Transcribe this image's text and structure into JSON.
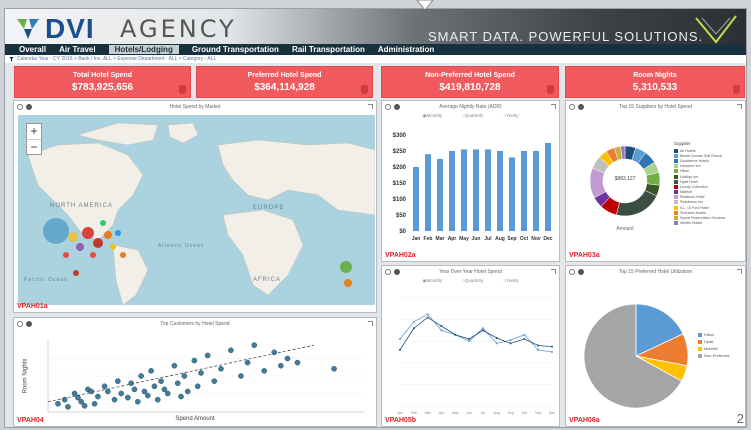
{
  "header": {
    "logo": "DVI",
    "agency": "AGENCY",
    "tagline": "SMART DATA. POWERFUL SOLUTIONS."
  },
  "nav": [
    "Overall",
    "Air Travel",
    "Hotels/Lodging",
    "Ground Transportation",
    "Rail Transportation",
    "Administration"
  ],
  "nav_active": 2,
  "filters": "Calendar Year - CY 2016 > Bank / Inc. ALL > Expense Department - ALL > Category - ALL",
  "kpis": [
    {
      "label": "Total Hotel Spend",
      "value": "$783,925,656"
    },
    {
      "label": "Preferred Hotel Spend",
      "value": "$364,114,928"
    },
    {
      "label": "Non-Preferred Hotel Spend",
      "value": "$419,810,728"
    },
    {
      "label": "Room Nights",
      "value": "5,310,533"
    }
  ],
  "panels": {
    "map": {
      "title": "Hotel Spend by Market",
      "code": "VPAH01a",
      "zoom_in": "+",
      "zoom_out": "−",
      "labels": [
        "NORTH AMERICA",
        "EUROPE",
        "AFRICA",
        "Atlantic Ocean",
        "Pacific Ocean"
      ]
    },
    "adr": {
      "title": "Average Nightly Rate (ADR)",
      "code": "VPAH02a",
      "options": [
        "Monthly",
        "Quarterly",
        "Yearly"
      ]
    },
    "suppliers": {
      "title": "Top 15 Suppliers by Hotel Spend",
      "code": "VPAH03a",
      "center_value": "$883,127",
      "inner_label": "Amount",
      "legend_title": "Supplier"
    },
    "yoy": {
      "title": "Year Over Year Hotel Spend",
      "code": "VPAH05b",
      "options": [
        "Monthly",
        "Quarterly",
        "Yearly"
      ]
    },
    "customers": {
      "title": "Top Customers by Hotel Spend",
      "code": "VPAH04",
      "xlabel": "Spend Amount",
      "ylabel": "Room Nights"
    },
    "preferred": {
      "title": "Top 15 Preferred Hotel Utilization",
      "code": "VPAH06a"
    }
  },
  "page_number": "2",
  "colors": {
    "kpi": "#f05a5f",
    "bar": "#5b9bd5",
    "nav": "#17313f",
    "code": "#e3232b"
  },
  "chart_data": [
    {
      "type": "bar",
      "title": "Average Nightly Rate (ADR)",
      "categories": [
        "Jan",
        "Feb",
        "Mar",
        "Apr",
        "May",
        "Jun",
        "Jul",
        "Aug",
        "Sep",
        "Oct",
        "Nov",
        "Dec"
      ],
      "values": [
        200,
        240,
        225,
        250,
        255,
        255,
        255,
        250,
        230,
        250,
        250,
        275
      ],
      "yticks": [
        "$300",
        "$250",
        "$200",
        "$150",
        "$100",
        "$50",
        "$0"
      ],
      "ylim": [
        0,
        300
      ]
    },
    {
      "type": "pie",
      "title": "Top 15 Suppliers by Hotel Spend",
      "donut": true,
      "series": [
        {
          "name": "Air Hotels",
          "value": 5,
          "color": "#1f4e79"
        },
        {
          "name": "Baxter Dumas Golf Resort",
          "value": 5,
          "color": "#5b9bd5"
        },
        {
          "name": "Doubletree Hotels",
          "value": 6,
          "color": "#2e75b6"
        },
        {
          "name": "Hampton Inn",
          "value": 5,
          "color": "#a9d18e"
        },
        {
          "name": "Hilton",
          "value": 6,
          "color": "#70ad47"
        },
        {
          "name": "Holiday Inn",
          "value": 5,
          "color": "#385723"
        },
        {
          "name": "Hyatt Hotel",
          "value": 22,
          "color": "#3a4e42"
        },
        {
          "name": "Luxury Collection",
          "value": 8,
          "color": "#c00000"
        },
        {
          "name": "Marriott",
          "value": 5,
          "color": "#7030a0"
        },
        {
          "name": "Radisson Hotel",
          "value": 14,
          "color": "#c39bd3"
        },
        {
          "name": "Residence Inn",
          "value": 6,
          "color": "#bfbfbf"
        },
        {
          "name": "S.L. Gl Ford Hotel",
          "value": 4,
          "color": "#ffc000"
        },
        {
          "name": "Sheraton Hotels",
          "value": 4,
          "color": "#ed7d31"
        },
        {
          "name": "Synrel Reservation Services",
          "value": 3,
          "color": "#c9b03c"
        },
        {
          "name": "Westin Hotels",
          "value": 2,
          "color": "#8e7cc3"
        }
      ]
    },
    {
      "type": "line",
      "title": "Year Over Year Hotel Spend",
      "x": [
        "Jan",
        "Feb",
        "Mar",
        "Apr",
        "May",
        "Jun",
        "Jul",
        "Aug",
        "Sep",
        "Oct",
        "Nov",
        "Dec"
      ],
      "series": [
        {
          "values": [
            62,
            78,
            85,
            70,
            66,
            60,
            72,
            58,
            61,
            66,
            52,
            50
          ]
        },
        {
          "values": [
            52,
            72,
            82,
            74,
            66,
            62,
            70,
            63,
            58,
            62,
            56,
            55
          ]
        }
      ]
    },
    {
      "type": "scatter",
      "title": "Top Customers by Hotel Spend",
      "xlabel": "Spend Amount",
      "ylabel": "Room Nights",
      "points": [
        [
          5,
          12
        ],
        [
          8,
          18
        ],
        [
          10,
          10
        ],
        [
          12,
          22
        ],
        [
          14,
          8
        ],
        [
          15,
          15
        ],
        [
          17,
          25
        ],
        [
          18,
          20
        ],
        [
          20,
          12
        ],
        [
          21,
          30
        ],
        [
          22,
          18
        ],
        [
          24,
          14
        ],
        [
          25,
          28
        ],
        [
          26,
          22
        ],
        [
          27,
          10
        ],
        [
          28,
          35
        ],
        [
          29,
          20
        ],
        [
          30,
          16
        ],
        [
          31,
          40
        ],
        [
          32,
          25
        ],
        [
          33,
          12
        ],
        [
          34,
          30
        ],
        [
          35,
          22
        ],
        [
          36,
          18
        ],
        [
          38,
          45
        ],
        [
          39,
          28
        ],
        [
          40,
          15
        ],
        [
          41,
          35
        ],
        [
          42,
          20
        ],
        [
          44,
          50
        ],
        [
          45,
          25
        ],
        [
          46,
          38
        ],
        [
          48,
          55
        ],
        [
          50,
          30
        ],
        [
          52,
          42
        ],
        [
          55,
          60
        ],
        [
          58,
          35
        ],
        [
          60,
          48
        ],
        [
          62,
          65
        ],
        [
          65,
          40
        ],
        [
          68,
          58
        ],
        [
          70,
          45
        ],
        [
          72,
          52
        ],
        [
          75,
          48
        ],
        [
          86,
          42
        ],
        [
          3,
          8
        ],
        [
          6,
          5
        ],
        [
          9,
          14
        ],
        [
          11,
          6
        ],
        [
          13,
          20
        ]
      ],
      "trendline": true
    },
    {
      "type": "pie",
      "title": "Top 15 Preferred Hotel Utilization",
      "series": [
        {
          "name": "Hilton",
          "value": 18,
          "color": "#5b9bd5"
        },
        {
          "name": "Hyatt",
          "value": 10,
          "color": "#ed7d31"
        },
        {
          "name": "Marriott",
          "value": 5,
          "color": "#ffc000"
        },
        {
          "name": "Non-Preferred",
          "value": 67,
          "color": "#a5a5a5"
        }
      ]
    }
  ]
}
